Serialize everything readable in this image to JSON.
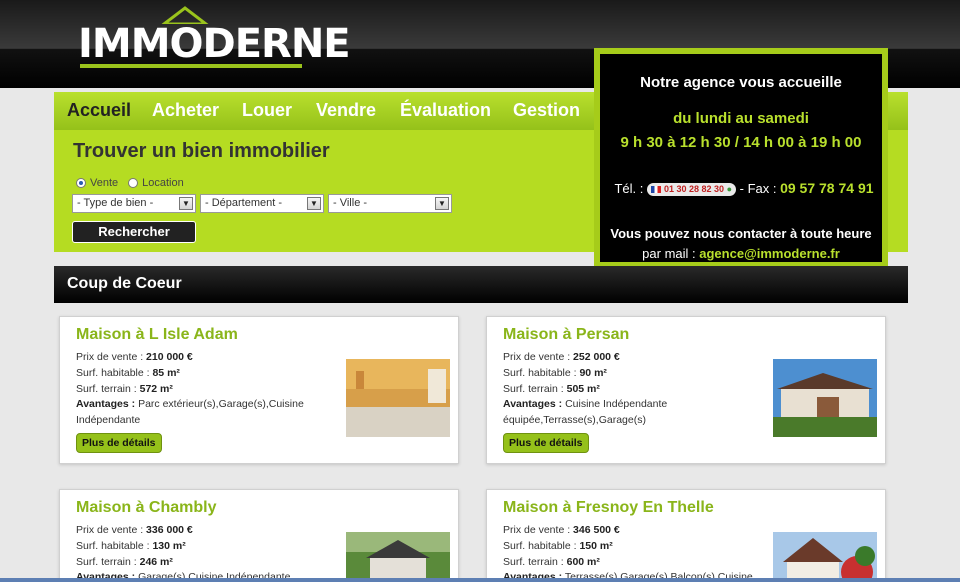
{
  "logo": {
    "text": "IMMODERNE"
  },
  "nav": {
    "items": [
      {
        "label": "Accueil",
        "active": true
      },
      {
        "label": "Acheter"
      },
      {
        "label": "Louer"
      },
      {
        "label": "Vendre"
      },
      {
        "label": "Évaluation"
      },
      {
        "label": "Gestion"
      }
    ]
  },
  "search": {
    "title": "Trouver un bien immobilier",
    "radio_vente": "Vente",
    "radio_location": "Location",
    "selected_radio": "Vente",
    "select_type": "- Type de bien -",
    "select_departement": "- Département -",
    "select_ville": "- Ville -",
    "button": "Rechercher"
  },
  "agency": {
    "title": "Notre agence vous accueille",
    "days": "du lundi au samedi",
    "hours": "9 h 30 à 12 h 30 / 14 h 00 à 19 h 00",
    "tel_label": "Tél. :",
    "tel_number": "01 30 28 82 30",
    "fax_label": "- Fax :",
    "fax_number": "09 57 78 74 91",
    "contact_line": "Vous pouvez nous contacter à toute heure",
    "mail_label": "par mail :",
    "mail": "agence@immoderne.fr"
  },
  "coup_de_coeur": {
    "title": "Coup de Coeur"
  },
  "labels": {
    "prix": "Prix de vente :",
    "habitable": "Surf. habitable :",
    "terrain": "Surf. terrain :",
    "avantages": "Avantages :",
    "details": "Plus de détails"
  },
  "listings": [
    {
      "title": "Maison à L Isle Adam",
      "prix": "210 000 €",
      "habitable": "85 m²",
      "terrain": "572 m²",
      "avantages": "Parc extérieur(s),Garage(s),Cuisine Indépendante"
    },
    {
      "title": "Maison à Persan",
      "prix": "252 000 €",
      "habitable": "90 m²",
      "terrain": "505 m²",
      "avantages": "Cuisine Indépendante équipée,Terrasse(s),Garage(s)"
    },
    {
      "title": "Maison à Chambly",
      "prix": "336 000 €",
      "habitable": "130 m²",
      "terrain": "246 m²",
      "avantages": "Garage(s),Cuisine Indépendante"
    },
    {
      "title": "Maison à Fresnoy En Thelle",
      "prix": "346 500 €",
      "habitable": "150 m²",
      "terrain": "600 m²",
      "avantages": "Terrasse(s),Garage(s),Balcon(s),Cuisine"
    }
  ],
  "colors": {
    "accent": "#a6cc1a",
    "title_green": "#8ab51a",
    "dark": "#000000"
  }
}
